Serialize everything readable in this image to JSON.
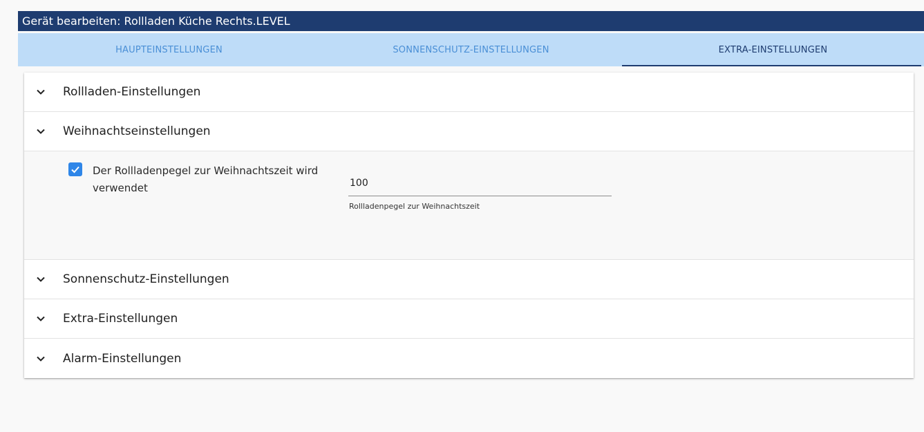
{
  "dialog": {
    "title": "Gerät bearbeiten: Rollladen Küche Rechts.LEVEL"
  },
  "tabs": [
    {
      "label": "HAUPTEINSTELLUNGEN",
      "active": false
    },
    {
      "label": "SONNENSCHUTZ-EINSTELLUNGEN",
      "active": false
    },
    {
      "label": "EXTRA-EINSTELLUNGEN",
      "active": true
    }
  ],
  "sections": [
    {
      "label": "Rollladen-Einstellungen",
      "expanded": false
    },
    {
      "label": "Weihnachtseinstellungen",
      "expanded": true
    },
    {
      "label": "Sonnenschutz-Einstellungen",
      "expanded": false
    },
    {
      "label": "Extra-Einstellungen",
      "expanded": false
    },
    {
      "label": "Alarm-Einstellungen",
      "expanded": false
    }
  ],
  "christmas": {
    "checkbox_label": "Der Rollladenpegel zur Weihnachtszeit wird verwendet",
    "checked": true,
    "level_value": "100",
    "level_helper": "Rollladenpegel zur Weihnachtszeit"
  },
  "icons": {
    "chevron": "chevron-down-icon",
    "check": "check-icon"
  },
  "colors": {
    "title_bar": "#1e3c70",
    "tab_bar": "#bedcf8",
    "tab_inactive_text": "#4a8fd6",
    "tab_active_text": "#1e3c70",
    "checkbox": "#2f86e8"
  }
}
